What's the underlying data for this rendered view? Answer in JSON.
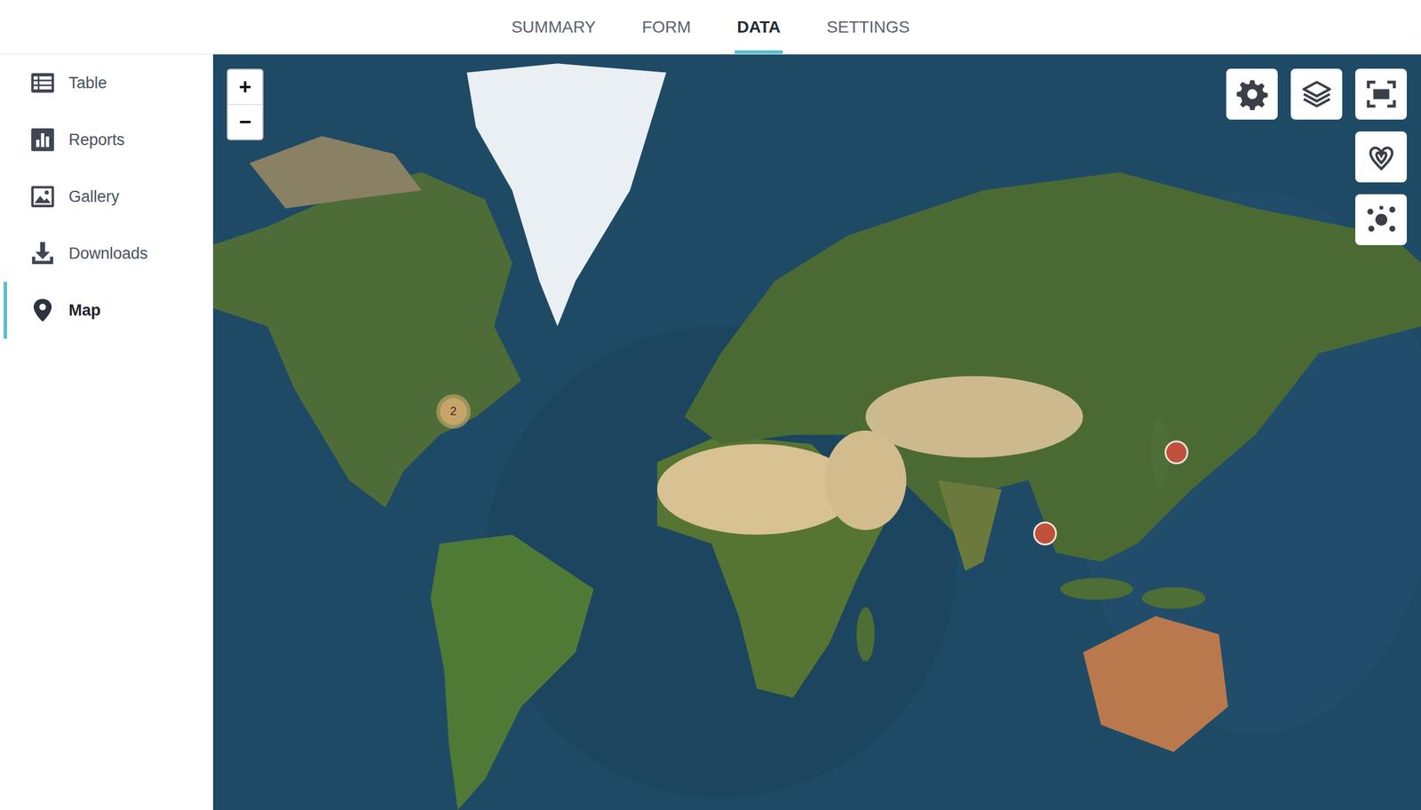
{
  "tabs": [
    {
      "label": "SUMMARY",
      "selected": false
    },
    {
      "label": "FORM",
      "selected": false
    },
    {
      "label": "DATA",
      "selected": true
    },
    {
      "label": "SETTINGS",
      "selected": false
    }
  ],
  "sidebar": {
    "items": [
      {
        "label": "Table",
        "icon": "table",
        "selected": false
      },
      {
        "label": "Reports",
        "icon": "reports",
        "selected": false
      },
      {
        "label": "Gallery",
        "icon": "gallery",
        "selected": false
      },
      {
        "label": "Downloads",
        "icon": "downloads",
        "selected": false
      },
      {
        "label": "Map",
        "icon": "map",
        "selected": true
      }
    ]
  },
  "map": {
    "zoom_controls": [
      "+",
      "−"
    ],
    "pins": [
      {
        "kind": "cluster",
        "label": "2",
        "color": "#c9a46a"
      },
      {
        "kind": "point",
        "label": "",
        "color": "#c0503c"
      },
      {
        "kind": "point",
        "label": "",
        "color": "#c0503c"
      }
    ]
  }
}
